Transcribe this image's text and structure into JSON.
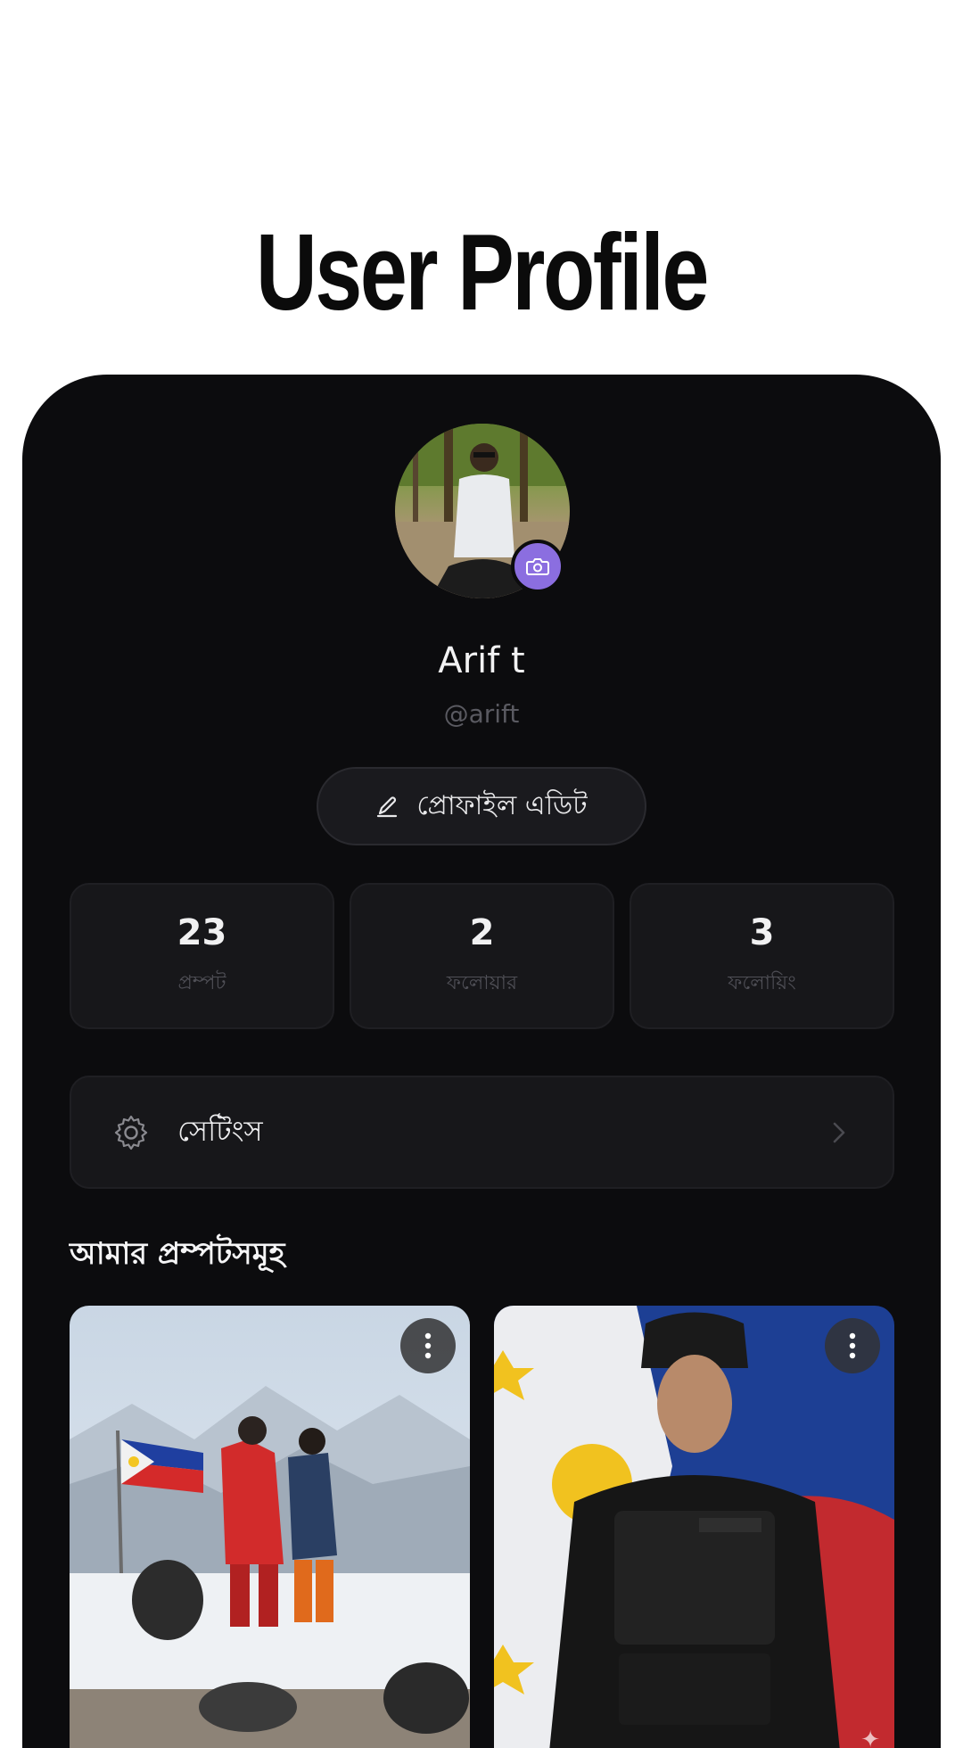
{
  "page": {
    "heading": "User Profile"
  },
  "profile": {
    "name": "Arif t",
    "handle": "@arift",
    "edit_label": "প্রোফাইল এডিট"
  },
  "stats": [
    {
      "value": "23",
      "label": "প্রম্পট"
    },
    {
      "value": "2",
      "label": "ফলোয়ার"
    },
    {
      "value": "3",
      "label": "ফলোয়িং"
    }
  ],
  "settings": {
    "label": "সেটিংস"
  },
  "prompts_section": {
    "title": "আমার প্রম্পটসমূহ",
    "cards": [
      {
        "image": "mountain-summit-climbers-philippine-flag"
      },
      {
        "image": "tactical-officer-philippine-flag"
      }
    ]
  },
  "colors": {
    "background": "#0c0c0e",
    "card": "#17171a",
    "accent": "#8b6ee0"
  }
}
